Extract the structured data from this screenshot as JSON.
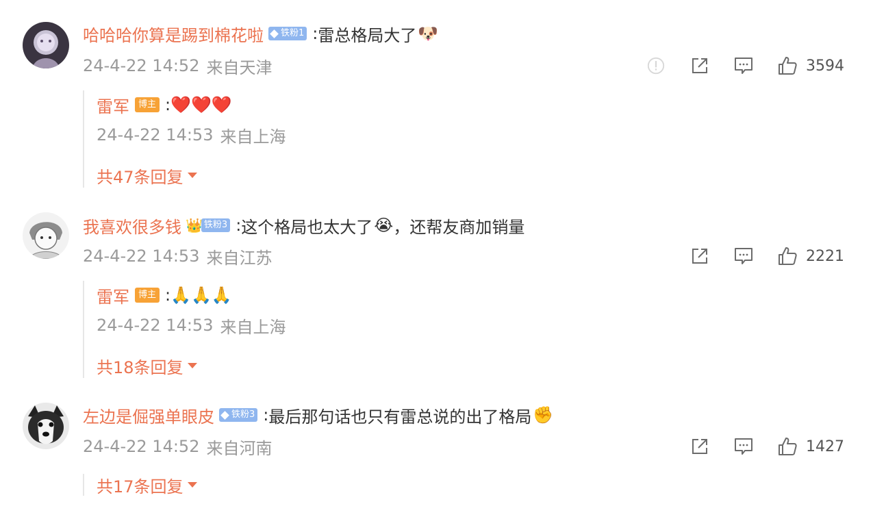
{
  "comments": [
    {
      "username": "哈哈哈你算是踢到棉花啦",
      "badge": "铁粉1",
      "colon": ":",
      "text": "雷总格局大了",
      "emoji": "🐶",
      "time": "24-4-22 14:52",
      "source": "来自天津",
      "likes": "3594",
      "reply": {
        "username": "雷军",
        "badge": "博主",
        "colon": ":",
        "text": "❤️❤️❤️",
        "time": "24-4-22 14:53",
        "source": "来自上海"
      },
      "more_replies": "共47条回复"
    },
    {
      "username": "我喜欢很多钱",
      "badge": "铁粉3",
      "colon": ":",
      "text": "这个格局也太大了",
      "emoji": "😭",
      "text2": "，还帮友商加销量",
      "time": "24-4-22 14:53",
      "source": "来自江苏",
      "likes": "2221",
      "reply": {
        "username": "雷军",
        "badge": "博主",
        "colon": ":",
        "text": "🙏🙏🙏",
        "time": "24-4-22 14:53",
        "source": "来自上海"
      },
      "more_replies": "共18条回复"
    },
    {
      "username": "左边是倔强单眼皮",
      "badge": "铁粉3",
      "colon": ":",
      "text": "最后那句话也只有雷总说的出了格局",
      "emoji": "✊",
      "time": "24-4-22 14:52",
      "source": "来自河南",
      "likes": "1427",
      "more_replies": "共17条回复"
    }
  ],
  "icons": {
    "report": "report-icon",
    "share": "share-icon",
    "comment": "comment-icon",
    "like": "like-icon"
  },
  "colors": {
    "username": "#eb7350",
    "meta": "#9a9a9a",
    "fan_badge": "#8fb6ef",
    "host_badge": "#f7a236"
  }
}
